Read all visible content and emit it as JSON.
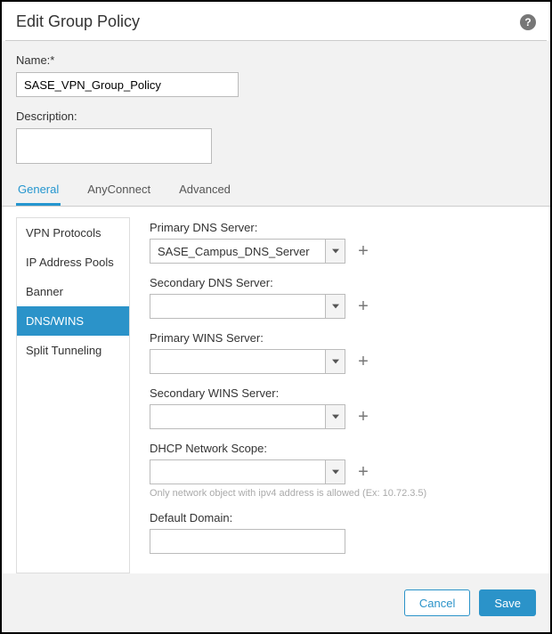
{
  "window": {
    "title": "Edit Group Policy"
  },
  "labels": {
    "name": "Name:*",
    "description": "Description:"
  },
  "values": {
    "name": "SASE_VPN_Group_Policy",
    "description": ""
  },
  "tabs": [
    {
      "label": "General",
      "active": true
    },
    {
      "label": "AnyConnect",
      "active": false
    },
    {
      "label": "Advanced",
      "active": false
    }
  ],
  "sidebar": {
    "items": [
      {
        "label": "VPN Protocols",
        "active": false
      },
      {
        "label": "IP Address Pools",
        "active": false
      },
      {
        "label": "Banner",
        "active": false
      },
      {
        "label": "DNS/WINS",
        "active": true
      },
      {
        "label": "Split Tunneling",
        "active": false
      }
    ]
  },
  "form": {
    "primary_dns": {
      "label": "Primary DNS Server:",
      "value": "SASE_Campus_DNS_Server"
    },
    "secondary_dns": {
      "label": "Secondary DNS Server:",
      "value": ""
    },
    "primary_wins": {
      "label": "Primary WINS Server:",
      "value": ""
    },
    "secondary_wins": {
      "label": "Secondary WINS Server:",
      "value": ""
    },
    "dhcp_scope": {
      "label": "DHCP Network Scope:",
      "value": "",
      "hint": "Only network object with ipv4 address is allowed (Ex: 10.72.3.5)"
    },
    "default_domain": {
      "label": "Default Domain:",
      "value": ""
    }
  },
  "footer": {
    "cancel": "Cancel",
    "save": "Save"
  }
}
